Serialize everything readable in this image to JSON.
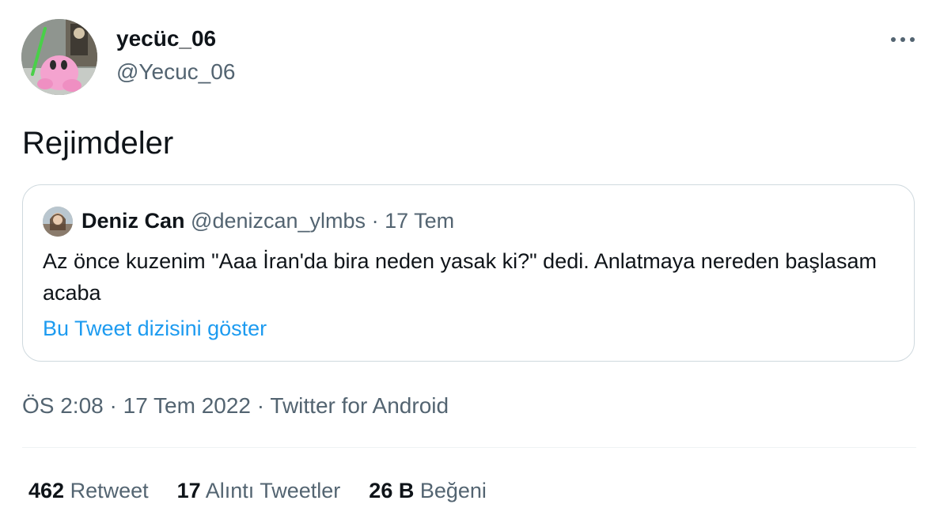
{
  "author": {
    "display_name": "yecüc_06",
    "handle": "@Yecuc_06",
    "avatar_icon": "avatar-pink-creature-icon"
  },
  "more_icon": "more-options-icon",
  "tweet_text": "Rejimdeler",
  "quoted_tweet": {
    "avatar_icon": "avatar-photo-icon",
    "display_name": "Deniz Can",
    "handle": "@denizcan_ylmbs",
    "separator": "·",
    "date": "17 Tem",
    "text": "Az önce kuzenim \"Aaa İran'da bira neden yasak ki?\" dedi. Anlatmaya nereden başlasam acaba",
    "thread_link": "Bu Tweet dizisini göster"
  },
  "meta": {
    "time": "ÖS 2:08",
    "separator": "·",
    "date": "17 Tem 2022",
    "source": "Twitter for Android"
  },
  "stats": [
    {
      "value": "462",
      "label": "Retweet"
    },
    {
      "value": "17",
      "label": "Alıntı Tweetler"
    },
    {
      "value": "26 B",
      "label": "Beğeni"
    }
  ],
  "colors": {
    "text": "#0f1419",
    "secondary": "#536471",
    "link": "#1d9bf0",
    "border": "#cfd9de"
  }
}
